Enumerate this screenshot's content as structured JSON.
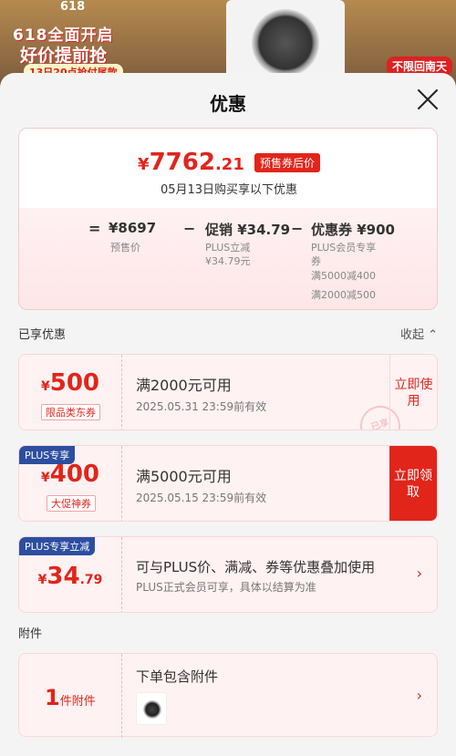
{
  "banner": {
    "brand": "618",
    "headline1": "618全面开启",
    "headline2": "好价提前抢",
    "subline": "13日20点抢付尾款",
    "right_tag": "不限回南天"
  },
  "sheet": {
    "title": "优惠",
    "close_icon": "close-icon"
  },
  "price": {
    "currency": "¥",
    "final_int": "7762",
    "final_dec": ".21",
    "final_tag": "预售券后价",
    "date_note": "05月13日购买享以下优惠",
    "eq": "=",
    "presale_value": "¥8697",
    "presale_label": "预售价",
    "minus1": "−",
    "promo_value": "促销 ¥34.79",
    "promo_sub1": "PLUS立减",
    "promo_sub2": "¥34.79元",
    "minus2": "−",
    "coupon_value": "优惠券 ¥900",
    "coupon_sub1": "PLUS会员专享",
    "coupon_sub2": "券",
    "coupon_sub3": "满5000减400",
    "coupon_sub4": "满2000减500"
  },
  "enjoyed": {
    "title": "已享优惠",
    "collapse": "收起 ⌃"
  },
  "coupons": [
    {
      "currency": "¥",
      "amount": "500",
      "badge": "限品类东券",
      "condition": "满2000元可用",
      "validity": "2025.05.31  23:59前有效",
      "action": "立即使用",
      "stamp": "已享"
    },
    {
      "plus_tag": "PLUS专享",
      "currency": "¥",
      "amount": "400",
      "badge": "大促神券",
      "condition": "满5000元可用",
      "validity": "2025.05.15  23:59前有效",
      "action": "立即领取"
    }
  ],
  "plus_discount": {
    "tag": "PLUS专享立减",
    "currency": "¥",
    "amount_int": "34",
    "amount_dec": ".79",
    "desc1": "可与PLUS价、满减、券等优惠叠加使用",
    "desc2": "PLUS正式会员可享，具体以结算为准",
    "chevron": "›"
  },
  "attachment": {
    "title": "附件",
    "count": "1",
    "unit": "件附件",
    "desc": "下单包含附件",
    "chevron": "›"
  }
}
